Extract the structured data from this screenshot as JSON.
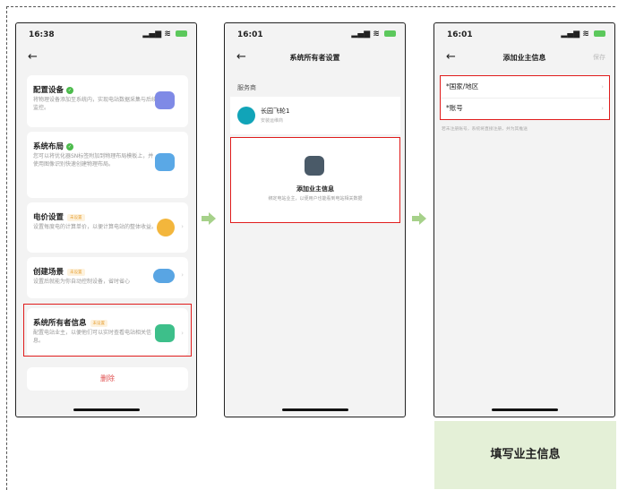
{
  "left": {
    "time": "16:38",
    "cards": [
      {
        "title": "配置设备",
        "desc": "将物理设备添加至系统内，实现电站数据采集与后续监控。",
        "status": "done"
      },
      {
        "title": "系统布局",
        "desc": "您可以将优化器SN标签附加到物理布局模板上，并使用图像识别快速创建物理布局。",
        "status": "done"
      },
      {
        "title": "电价设置",
        "tag": "未设置",
        "desc": "设置每度电的计算单价，以便计算电站的整体收益。"
      },
      {
        "title": "创建场景",
        "tag": "未设置",
        "desc": "设置后就能为你自动控制设备，省时省心"
      },
      {
        "title": "系统所有者信息",
        "tag": "未设置",
        "desc": "配置电站业主，以便他们可以实时查看电站相关信息。"
      }
    ],
    "delete_label": "删除"
  },
  "middle": {
    "time": "16:01",
    "title": "系统所有者设置",
    "section": "服务商",
    "provider_name": "长园飞轮1",
    "provider_role": "安装运维商",
    "add_title": "添加业主信息",
    "add_desc": "绑定电站业主，以便用户也能看到电站相关数据"
  },
  "right": {
    "time": "16:01",
    "title": "添加业主信息",
    "save_label": "保存",
    "row1": "*国家/地区",
    "row2": "*账号",
    "hint": "若未注册账号，系统将直接注册，并为其推送"
  },
  "caption": "填写业主信息",
  "colors": {
    "highlight": "#e01c1c",
    "arrow": "#a6d18a",
    "caption_bg": "#e4f0d7"
  }
}
